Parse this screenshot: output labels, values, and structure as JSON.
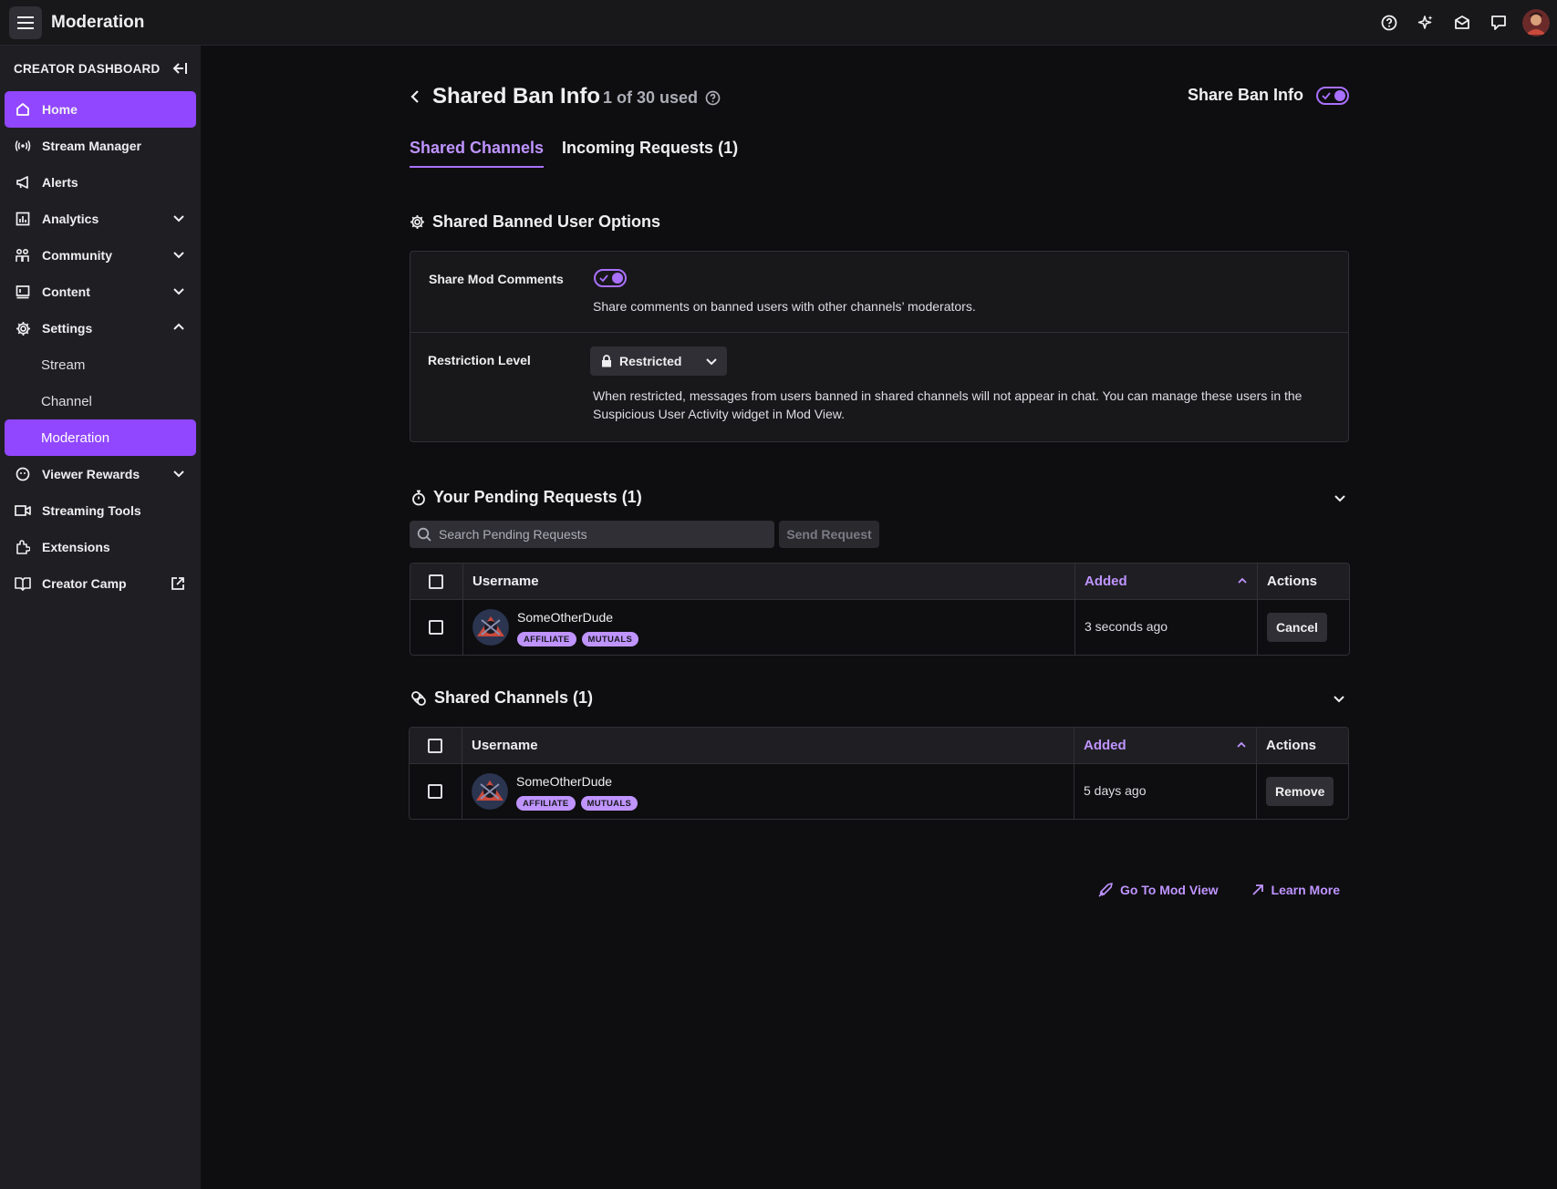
{
  "topbar": {
    "title": "Moderation",
    "icons": [
      "help-icon",
      "sparkle-icon",
      "inbox-icon",
      "whispers-icon"
    ]
  },
  "sidebar": {
    "header": "CREATOR DASHBOARD",
    "items": [
      {
        "label": "Home",
        "icon": "home-icon",
        "active": true
      },
      {
        "label": "Stream Manager",
        "icon": "broadcast-icon"
      },
      {
        "label": "Alerts",
        "icon": "megaphone-icon"
      },
      {
        "label": "Analytics",
        "icon": "analytics-icon",
        "chevron": "down"
      },
      {
        "label": "Community",
        "icon": "community-icon",
        "chevron": "down"
      },
      {
        "label": "Content",
        "icon": "content-icon",
        "chevron": "down"
      },
      {
        "label": "Settings",
        "icon": "gear-icon",
        "chevron": "up"
      }
    ],
    "sub_items": [
      {
        "label": "Stream"
      },
      {
        "label": "Channel"
      },
      {
        "label": "Moderation",
        "active": true
      }
    ],
    "items_after": [
      {
        "label": "Viewer Rewards",
        "icon": "rewards-icon",
        "chevron": "down"
      },
      {
        "label": "Streaming Tools",
        "icon": "camera-icon"
      },
      {
        "label": "Extensions",
        "icon": "extensions-icon"
      },
      {
        "label": "Creator Camp",
        "icon": "book-icon",
        "external": true
      }
    ]
  },
  "page": {
    "title": "Shared Ban Info",
    "usage": "1 of 30 used",
    "share_ban_label": "Share Ban Info",
    "share_ban_enabled": true,
    "tabs": [
      {
        "label": "Shared Channels",
        "active": true
      },
      {
        "label": "Incoming Requests (1)"
      }
    ]
  },
  "options": {
    "title": "Shared Banned User Options",
    "mod_comments_label": "Share Mod Comments",
    "mod_comments_enabled": true,
    "mod_comments_desc": "Share comments on banned users with other channels’ moderators.",
    "restriction_label": "Restriction Level",
    "restriction_value": "Restricted",
    "restriction_desc_1": "When restricted, messages from users banned in shared channels will not appear in chat.  You can manage these users in the",
    "restriction_desc_2": "Suspicious User Activity widget in Mod View."
  },
  "pending": {
    "title": "Your Pending Requests (1)",
    "search_placeholder": "Search Pending Requests",
    "send_label": "Send Request",
    "columns": {
      "username": "Username",
      "added": "Added",
      "actions": "Actions"
    },
    "rows": [
      {
        "username": "SomeOtherDude",
        "badges": [
          "AFFILIATE",
          "MUTUALS"
        ],
        "added": "3 seconds ago",
        "action": "Cancel"
      }
    ]
  },
  "shared": {
    "title": "Shared Channels (1)",
    "columns": {
      "username": "Username",
      "added": "Added",
      "actions": "Actions"
    },
    "rows": [
      {
        "username": "SomeOtherDude",
        "badges": [
          "AFFILIATE",
          "MUTUALS"
        ],
        "added": "5 days ago",
        "action": "Remove"
      }
    ]
  },
  "footer": {
    "mod_view": "Go To Mod View",
    "learn_more": "Learn More"
  },
  "colors": {
    "accent": "#9147ff",
    "accent_light": "#bf94ff",
    "background": "#0e0e10",
    "sidebar": "#1f1f23"
  }
}
